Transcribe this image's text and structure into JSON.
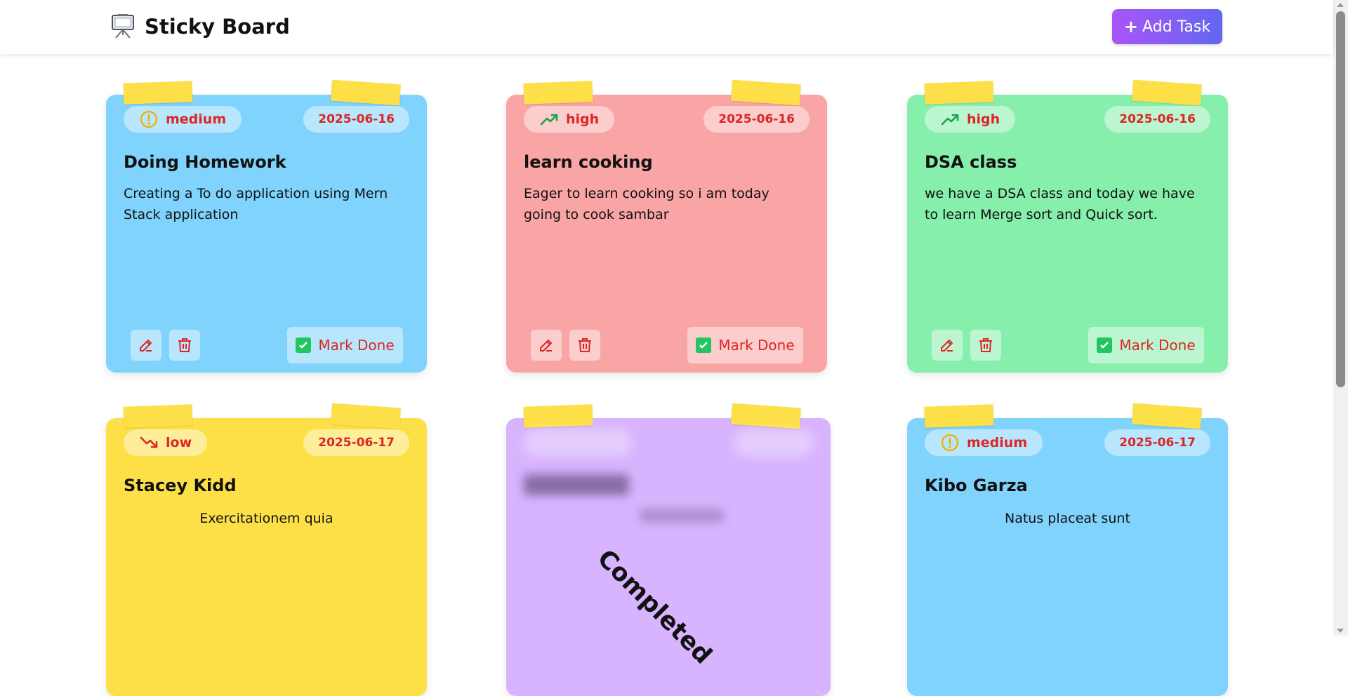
{
  "header": {
    "title": "Sticky Board",
    "add_button": "Add Task",
    "add_plus": "+"
  },
  "colors": {
    "blue": "#7fd3fc",
    "red": "#f9a5a5",
    "green": "#86efac",
    "yellow": "#fde047",
    "purple": "#d8b4fe",
    "accent_text": "#dc2626",
    "button_gradient": [
      "#a855f7",
      "#6366f1"
    ]
  },
  "actions": {
    "mark_done": "Mark Done",
    "edit_icon": "pencil-icon",
    "delete_icon": "trash-icon",
    "check_icon": "check-box-icon"
  },
  "tasks": [
    {
      "priority": "medium",
      "priority_icon": "alert-circle-icon",
      "date": "2025-06-16",
      "title": "Doing Homework",
      "description": "Creating a To do application using Mern Stack application",
      "color": "blue"
    },
    {
      "priority": "high",
      "priority_icon": "trending-up-icon",
      "date": "2025-06-16",
      "title": "learn cooking",
      "description": "Eager to learn cooking so i am today going to cook sambar",
      "color": "red"
    },
    {
      "priority": "high",
      "priority_icon": "trending-up-icon",
      "date": "2025-06-16",
      "title": "DSA class",
      "description": "we have a DSA class and today we have to learn Merge sort and Quick sort.",
      "color": "green"
    },
    {
      "priority": "low",
      "priority_icon": "trending-down-icon",
      "date": "2025-06-17",
      "title": "Stacey Kidd",
      "description": "Exercitationem quia",
      "color": "yellow"
    },
    {
      "status": "Completed",
      "color": "purple"
    },
    {
      "priority": "medium",
      "priority_icon": "alert-circle-icon",
      "date": "2025-06-17",
      "title": "Kibo Garza",
      "description": "Natus placeat sunt",
      "color": "blue"
    }
  ]
}
